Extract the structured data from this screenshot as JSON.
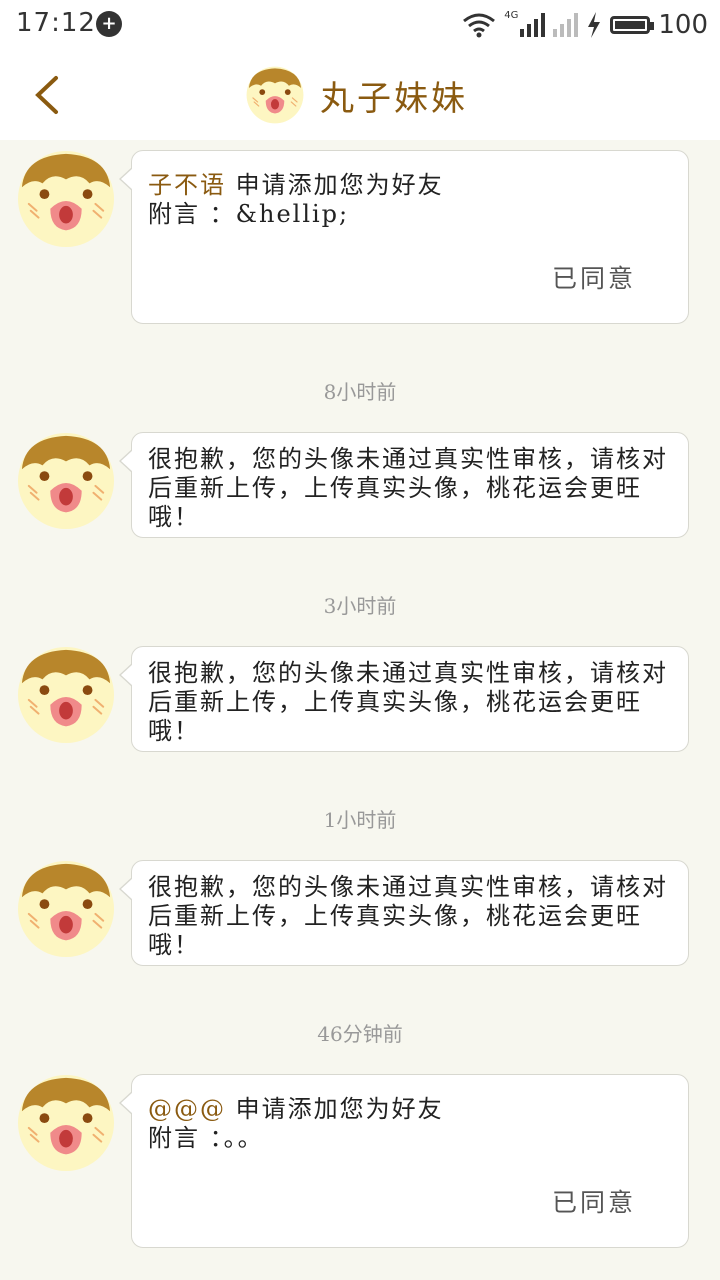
{
  "status_bar": {
    "time": "17:12",
    "network": "4G",
    "battery_level": "100"
  },
  "header": {
    "title": "丸子妹妹"
  },
  "messages": [
    {
      "sender": "子不语",
      "text": "申请添加您为好友",
      "note": "附言 ：&hellip;",
      "action": "已同意"
    },
    {
      "timestamp": "8小时前",
      "text": "很抱歉，您的头像未通过真实性审核，请核对后重新上传，上传真实头像，桃花运会更旺哦！"
    },
    {
      "timestamp": "3小时前",
      "text": "很抱歉，您的头像未通过真实性审核，请核对后重新上传，上传真实头像，桃花运会更旺哦！"
    },
    {
      "timestamp": "1小时前",
      "text": "很抱歉，您的头像未通过真实性审核，请核对后重新上传，上传真实头像，桃花运会更旺哦！"
    },
    {
      "timestamp": "46分钟前",
      "sender": "@@@",
      "text": "申请添加您为好友",
      "note": "附言 ：。。",
      "action": "已同意"
    }
  ],
  "colors": {
    "accent": "#8a5a10",
    "background": "#f7f7ef",
    "avatar_face": "#fdf6c2",
    "avatar_hair": "#b8862b"
  }
}
